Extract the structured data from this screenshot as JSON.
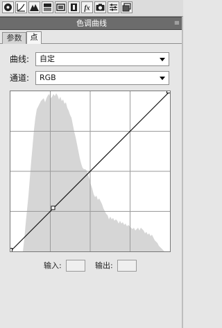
{
  "toolbar": {
    "icons": [
      "color-wheel-icon",
      "curves-icon",
      "mountain-icon",
      "split-tone-icon",
      "lens-icon",
      "fx-icon",
      "camera-icon",
      "sliders-icon",
      "snapshots-icon"
    ],
    "fx_label": "fx"
  },
  "panel": {
    "title": "色调曲线",
    "menu_glyph": "≡"
  },
  "tabs": [
    {
      "label": "参数",
      "active": false
    },
    {
      "label": "点",
      "active": true
    }
  ],
  "curve": {
    "label": "曲线:",
    "value": "自定"
  },
  "channel": {
    "label": "通道:",
    "value": "RGB"
  },
  "graph": {
    "control_points": [
      {
        "input": 0,
        "output": 0
      },
      {
        "input": 64,
        "output": 64
      },
      {
        "input": 255,
        "output": 255
      }
    ]
  },
  "io": {
    "input_label": "输入:",
    "output_label": "输出:",
    "input_value": "",
    "output_value": ""
  }
}
